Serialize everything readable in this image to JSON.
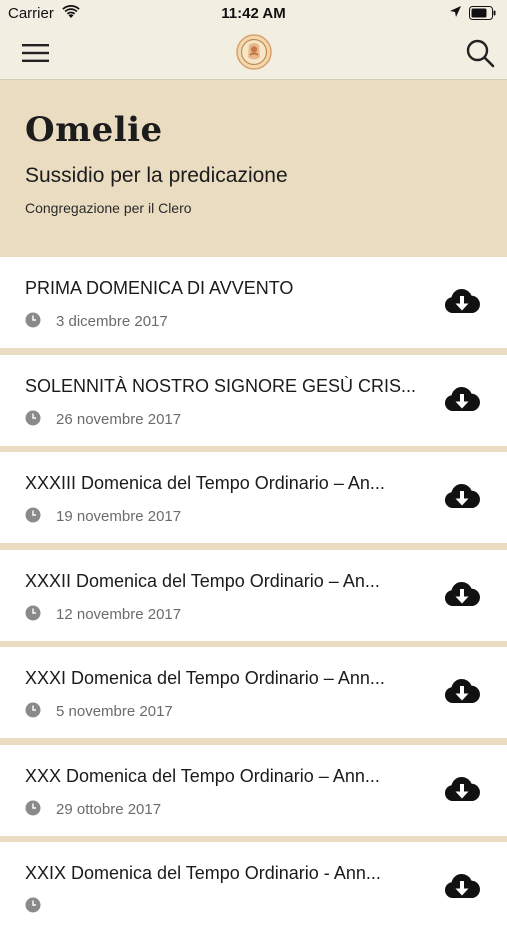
{
  "status_bar": {
    "carrier": "Carrier",
    "time": "11:42 AM"
  },
  "nav": {
    "menu_icon": "hamburger-icon",
    "logo_icon": "seal-logo",
    "search_icon": "search-icon"
  },
  "header": {
    "title": "Omelie",
    "subtitle": "Sussidio per la predicazione",
    "organization": "Congregazione per il Clero"
  },
  "colors": {
    "background": "#e9dcc0",
    "bar": "#f3eee2",
    "text": "#1b1b1b",
    "date": "#6b6b6b"
  },
  "homilies": [
    {
      "title": "PRIMA DOMENICA DI AVVENTO",
      "date": "3 dicembre 2017"
    },
    {
      "title": "SOLENNITÀ NOSTRO SIGNORE GESÙ CRIS...",
      "date": "26 novembre 2017"
    },
    {
      "title": "XXXIII Domenica del Tempo Ordinario – An...",
      "date": "19 novembre 2017"
    },
    {
      "title": "XXXII Domenica del Tempo Ordinario – An...",
      "date": "12 novembre 2017"
    },
    {
      "title": "XXXI Domenica del Tempo Ordinario – Ann...",
      "date": "5 novembre 2017"
    },
    {
      "title": "XXX Domenica del Tempo Ordinario – Ann...",
      "date": "29 ottobre 2017"
    },
    {
      "title": "XXIX Domenica del Tempo Ordinario - Ann...",
      "date": ""
    }
  ]
}
